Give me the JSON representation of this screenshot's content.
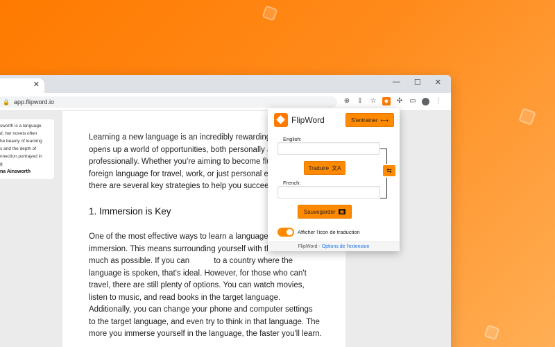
{
  "browser": {
    "tab_close": "✕",
    "window_controls": [
      "—",
      "☐",
      "✕"
    ],
    "url": "app.flipword.io",
    "toolbar_icons": [
      "zoom-icon",
      "share-icon",
      "bookmark-star-icon",
      "flipword-extension-icon",
      "extensions-puzzle-icon",
      "sidebar-icon",
      "profile-avatar",
      "more-menu-icon"
    ]
  },
  "side_card": {
    "lines": [
      "sworth is a language",
      "d, her novels often",
      "he beauty of learning",
      "s and the depth of",
      "nnection portrayed in",
      "g"
    ],
    "author": "na Ainsworth"
  },
  "article": {
    "intro": "Learning a new language is an incredibly rewarding\nopens up a world of opportunities, both personally a\nprofessionally. Whether you're aiming to become flu\nforeign language for travel, work, or just personal er\nthere are several key strategies to help you succeed",
    "heading": "1. Immersion is Key",
    "body": "One of the most effective ways to learn a language\nimmersion. This means surrounding yourself with th\nmuch as possible. If you can           to a country where the\nlanguage is spoken, that's ideal. However, for those who can't\ntravel, there are still plenty of options. You can watch movies,\nlisten to music, and read books in the target language.\nAdditionally, you can change your phone and computer settings\nto the target language, and even try to think in that language. The\nmore you immerse yourself in the language, the faster you'll learn."
  },
  "popup": {
    "brand": "FlipWord",
    "train_button": "S'entrainer",
    "english_label": "English:",
    "english_value": "",
    "translate_button": "Traduire",
    "french_label": "French:",
    "french_value": "",
    "save_button": "Sauvegarder",
    "toggle_label": "Afficher l'icon de traduction",
    "toggle_on": true,
    "footer_brand": "FlipWord",
    "footer_sep": " - ",
    "footer_link": "Options de l'extension",
    "accent_color": "#ff8a00"
  }
}
